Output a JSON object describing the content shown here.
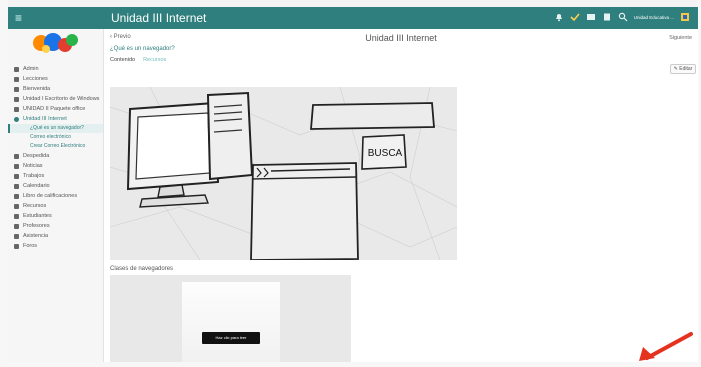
{
  "app": {
    "title": "Unidad III Internet",
    "user": "Unidad Educativa ..."
  },
  "colors": {
    "accent": "#2e7f7d",
    "arrow": "#e5321f"
  },
  "topbar_icons": [
    "menu-icon",
    "bell-icon",
    "check-icon",
    "mail-icon",
    "chat-icon",
    "search-icon",
    "avatar-icon"
  ],
  "sidebar": {
    "items": [
      {
        "label": "Admin",
        "icon": "admin-icon"
      },
      {
        "label": "Lecciones",
        "icon": "lessons-icon"
      },
      {
        "label": "Bienvenida",
        "icon": "welcome-icon"
      },
      {
        "label": "Unidad I Escritorio de Windows",
        "icon": "unit1-icon"
      },
      {
        "label": "UNIDAD II Paquete office",
        "icon": "unit2-icon"
      },
      {
        "label": "Unidad III Internet",
        "icon": "unit3-icon",
        "active": true
      },
      {
        "label": "Despedida",
        "icon": "goodbye-icon"
      },
      {
        "label": "Noticias",
        "icon": "news-icon"
      },
      {
        "label": "Trabajos",
        "icon": "assignments-icon"
      },
      {
        "label": "Calendario",
        "icon": "calendar-icon"
      },
      {
        "label": "Libro de calificaciones",
        "icon": "gradebook-icon"
      },
      {
        "label": "Recursos",
        "icon": "resources-icon"
      },
      {
        "label": "Estudiantes",
        "icon": "students-icon"
      },
      {
        "label": "Profesores",
        "icon": "teachers-icon"
      },
      {
        "label": "Asistencia",
        "icon": "attendance-icon"
      },
      {
        "label": "Foros",
        "icon": "forums-icon"
      }
    ],
    "subitems": [
      {
        "label": "¿Qué es un navegador?",
        "active": true
      },
      {
        "label": "Correo electrónico"
      },
      {
        "label": "Crear Correo Electrónico"
      }
    ]
  },
  "main": {
    "back_label": "Previo",
    "next_label": "Siguiente",
    "question": "¿Qué es un navegador?",
    "tabs": [
      "Contenido",
      "Recursos"
    ],
    "edit_label": "Editar",
    "search_button": "BUSCA",
    "caption": "Clases de navegadores",
    "video_button": "Haz clic para leer"
  }
}
